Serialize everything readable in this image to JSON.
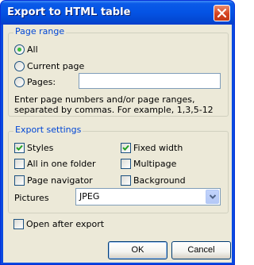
{
  "window": {
    "title": "Export to HTML table"
  },
  "page_range": {
    "legend": "Page range",
    "options": [
      {
        "label": "All",
        "selected": true
      },
      {
        "label": "Current page",
        "selected": false
      },
      {
        "label": "Pages:",
        "selected": false
      }
    ],
    "pages_value": "",
    "hint_line1": "Enter page numbers and/or page ranges,",
    "hint_line2": "separated by commas. For example, 1,3,5-12"
  },
  "export_settings": {
    "legend": "Export settings",
    "styles": {
      "label": "Styles",
      "checked": true
    },
    "fixed_width": {
      "label": "Fixed width",
      "checked": true
    },
    "all_in_one_folder": {
      "label": "All in one folder",
      "checked": false
    },
    "multipage": {
      "label": "Multipage",
      "checked": false
    },
    "page_navigator": {
      "label": "Page navigator",
      "checked": false
    },
    "background": {
      "label": "Background",
      "checked": false
    },
    "pictures_label": "Pictures",
    "pictures_value": "JPEG"
  },
  "open_after_export": {
    "label": "Open after export",
    "checked": false
  },
  "buttons": {
    "ok": "OK",
    "cancel": "Cancel"
  },
  "colors": {
    "title_bar": "#0453e4",
    "legend_text": "#0046d5",
    "dialog_bg": "#ece9d8",
    "check_green": "#21a121"
  },
  "icons": [
    "close-icon",
    "checkmark-icon",
    "dropdown-arrow-icon"
  ]
}
